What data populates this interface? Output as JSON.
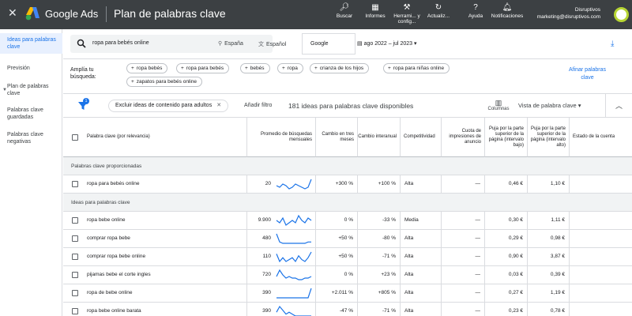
{
  "topbar": {
    "close_glyph": "✕",
    "brand": "Google Ads",
    "page_title": "Plan de palabras clave",
    "actions": [
      {
        "icon": "search-icon",
        "label": "Buscar"
      },
      {
        "icon": "reports-icon",
        "label": "Informes"
      },
      {
        "icon": "tools-icon",
        "label": "Herrami... y config..."
      },
      {
        "icon": "refresh-icon",
        "label": "Actualiz..."
      },
      {
        "icon": "help-icon",
        "label": "Ayuda"
      },
      {
        "icon": "bell-icon",
        "label": "Notificaciones"
      }
    ],
    "account_name": "Disruptivos",
    "account_email": "marketing@disruptivos.com"
  },
  "sidebar": {
    "items": [
      {
        "label": "Ideas para palabras clave",
        "active": true
      },
      {
        "label": "Previsión"
      },
      {
        "label": "Plan de palabras clave"
      },
      {
        "label": "Palabras clave guardadas"
      },
      {
        "label": "Palabras clave negativas"
      }
    ]
  },
  "search": {
    "query": "ropa para bebés online",
    "location": "España",
    "language": "Español",
    "engine": "Google",
    "date_range": "ago 2022 – jul 2023"
  },
  "broaden": {
    "label": "Amplía tu búsqueda:",
    "chips": [
      "ropa bebés",
      "ropa para bebés",
      "bebés",
      "ropa",
      "crianza de los hijos",
      "ropa para niñas online",
      "zapatos para bebés online"
    ],
    "refine_label": "Afinar palabras clave"
  },
  "filters": {
    "badge": "1",
    "chip_label": "Excluir ideas de contenido para adultos",
    "add_filter": "Añadir filtro",
    "count_text": "181 ideas para palabras clave disponibles",
    "columns_label": "Columnas",
    "view_label": "Vista de palabra clave"
  },
  "table": {
    "headers": {
      "keyword": "Palabra clave (por relevancia)",
      "avg_searches": "Promedio de búsquedas mensuales",
      "three_month": "Cambio en tres meses",
      "yoy": "Cambio interanual",
      "competition": "Competitividad",
      "impression_share": "Cuota de impresiones de anuncio",
      "bid_low": "Puja por la parte superior de la página (intervalo bajo)",
      "bid_high": "Puja por la parte superior de la página (intervalo alto)",
      "status": "Estado de la cuenta"
    },
    "provided_section": "Palabras clave proporcionadas",
    "ideas_section": "Ideas para palabras clave",
    "provided": [
      {
        "keyword": "ropa para bebés online",
        "avg": "20",
        "three": "+300 %",
        "yoy": "+100 %",
        "comp": "Alta",
        "share": "—",
        "low": "0,46 €",
        "high": "1,10 €",
        "trend": [
          5,
          4,
          6,
          5,
          3,
          4,
          6,
          5,
          4,
          3,
          4,
          9
        ]
      }
    ],
    "ideas": [
      {
        "keyword": "ropa bebe online",
        "avg": "9.900",
        "three": "0 %",
        "yoy": "-33 %",
        "comp": "Media",
        "share": "—",
        "low": "0,30 €",
        "high": "1,11 €",
        "trend": [
          6,
          5,
          7,
          4,
          5,
          6,
          5,
          8,
          6,
          5,
          7,
          6
        ]
      },
      {
        "keyword": "comprar ropa bebe",
        "avg": "480",
        "three": "+50 %",
        "yoy": "-80 %",
        "comp": "Alta",
        "share": "—",
        "low": "0,29 €",
        "high": "0,98 €",
        "trend": [
          9,
          3,
          2,
          2,
          2,
          2,
          2,
          2,
          2,
          2,
          3,
          3
        ]
      },
      {
        "keyword": "comprar ropa bebe online",
        "avg": "110",
        "three": "+50 %",
        "yoy": "-71 %",
        "comp": "Alta",
        "share": "—",
        "low": "0,90 €",
        "high": "3,87 €",
        "trend": [
          7,
          3,
          5,
          3,
          4,
          5,
          3,
          6,
          4,
          3,
          5,
          8
        ]
      },
      {
        "keyword": "pijamas bebe el corte ingles",
        "avg": "720",
        "three": "0 %",
        "yoy": "+23 %",
        "comp": "Alta",
        "share": "—",
        "low": "0,03 €",
        "high": "0,39 €",
        "trend": [
          4,
          8,
          5,
          3,
          4,
          3,
          3,
          2,
          2,
          3,
          3,
          4
        ]
      },
      {
        "keyword": "ropa de bebe online",
        "avg": "390",
        "three": "+2.011 %",
        "yoy": "+805 %",
        "comp": "Alta",
        "share": "—",
        "low": "0,27 €",
        "high": "1,19 €",
        "trend": [
          1,
          1,
          1,
          1,
          1,
          1,
          1,
          1,
          1,
          1,
          1,
          9
        ]
      },
      {
        "keyword": "ropa bebe online barata",
        "avg": "390",
        "three": "-47 %",
        "yoy": "-71 %",
        "comp": "Alta",
        "share": "—",
        "low": "0,23 €",
        "high": "0,78 €",
        "trend": [
          5,
          8,
          6,
          4,
          5,
          4,
          3,
          3,
          3,
          3,
          3,
          3
        ]
      }
    ]
  },
  "colors": {
    "accent": "#1a73e8",
    "topbar": "#3c4043",
    "sparkline": "#1a73e8"
  }
}
